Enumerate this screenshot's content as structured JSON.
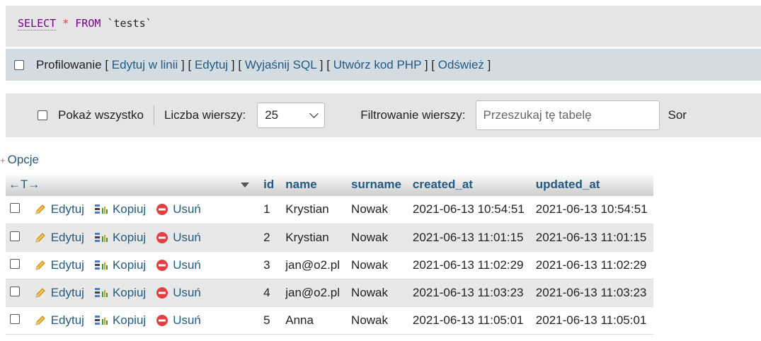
{
  "sql": {
    "select": "SELECT",
    "star": "*",
    "from": "FROM",
    "table": "`tests`"
  },
  "profiling": {
    "label": "Profilowanie",
    "links": [
      "Edytuj w linii",
      "Edytuj",
      "Wyjaśnij SQL",
      "Utwórz kod PHP",
      "Odśwież"
    ]
  },
  "nav": {
    "show_all": "Pokaż wszystko",
    "rows_label": "Liczba wierszy:",
    "rows_value": "25",
    "filter_label": "Filtrowanie wierszy:",
    "filter_placeholder": "Przeszukaj tę tabelę",
    "sort_cut": "Sor"
  },
  "options_label": "Opcje",
  "table": {
    "arrows": "←T→",
    "columns": [
      "id",
      "name",
      "surname",
      "created_at",
      "updated_at"
    ],
    "actions": {
      "edit": "Edytuj",
      "copy": "Kopiuj",
      "delete": "Usuń"
    },
    "rows": [
      {
        "id": "1",
        "name": "Krystian",
        "surname": "Nowak",
        "created_at": "2021-06-13 10:54:51",
        "updated_at": "2021-06-13 10:54:51"
      },
      {
        "id": "2",
        "name": "Krystian",
        "surname": "Nowak",
        "created_at": "2021-06-13 11:01:15",
        "updated_at": "2021-06-13 11:01:15"
      },
      {
        "id": "3",
        "name": "jan@o2.pl",
        "surname": "Nowak",
        "created_at": "2021-06-13 11:02:29",
        "updated_at": "2021-06-13 11:02:29"
      },
      {
        "id": "4",
        "name": "jan@o2.pl",
        "surname": "Nowak",
        "created_at": "2021-06-13 11:03:23",
        "updated_at": "2021-06-13 11:03:23"
      },
      {
        "id": "5",
        "name": "Anna",
        "surname": "Nowak",
        "created_at": "2021-06-13 11:05:01",
        "updated_at": "2021-06-13 11:05:01"
      }
    ]
  },
  "colors": {
    "link": "#235a81",
    "keyword": "#770088",
    "star": "#e23a3a",
    "delete_icon": "#e04040"
  },
  "icons": {
    "edit": "pencil-icon",
    "copy": "copy-icon",
    "delete": "delete-icon",
    "sort": "sort-desc-icon"
  }
}
